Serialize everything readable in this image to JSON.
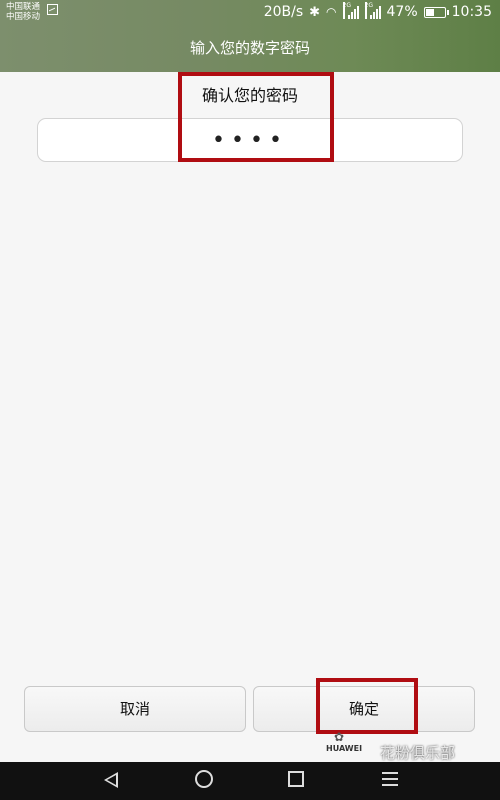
{
  "status_bar": {
    "carrier_1": "中国联通",
    "carrier_2": "中国移动",
    "net_speed": "20B/s",
    "signal_tag_1": "2G",
    "signal_tag_2": "2G",
    "battery": "47%",
    "battery_level": 0.47,
    "time": "10:35"
  },
  "header": {
    "title": "输入您的数字密码"
  },
  "pin": {
    "prompt": "确认您的密码",
    "masked_value": "••••"
  },
  "buttons": {
    "cancel": "取消",
    "confirm": "确定"
  },
  "brand": {
    "logo_text": "HUAWEI"
  },
  "watermark": "花粉俱乐部",
  "colors": {
    "accent_green": "#6e8a56",
    "highlight_red": "#b00d12"
  }
}
